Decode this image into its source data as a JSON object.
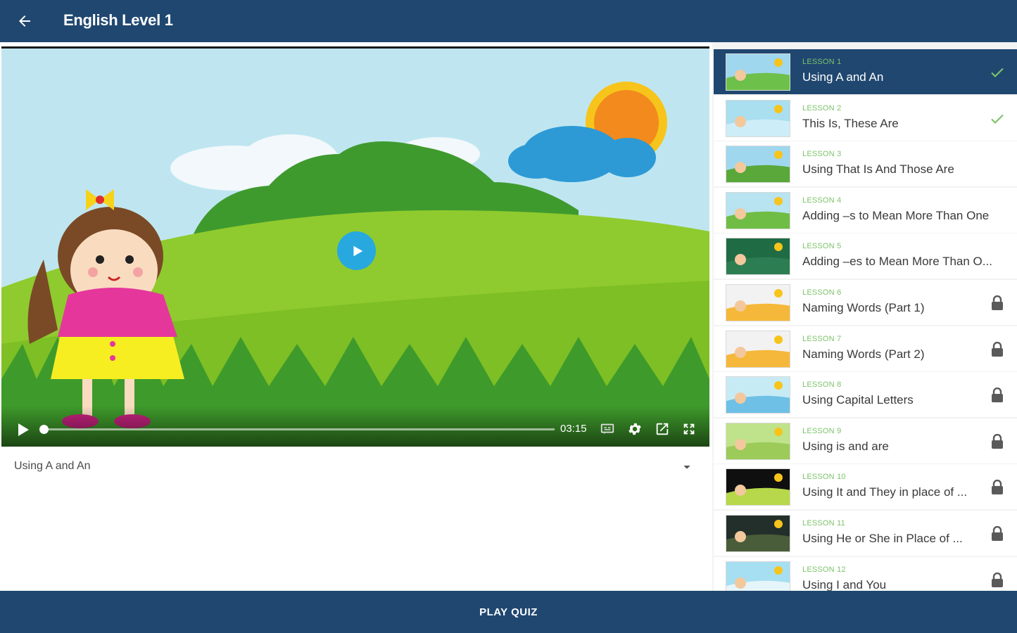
{
  "app": {
    "title": "English Level 1"
  },
  "player": {
    "current_time": "03:15",
    "progress": 0.0,
    "video_title": "Using A and An"
  },
  "lessons": [
    {
      "number": "LESSON 1",
      "name": "Using A and An",
      "status": "completed",
      "active": true
    },
    {
      "number": "LESSON 2",
      "name": "This Is, These Are",
      "status": "completed",
      "active": false
    },
    {
      "number": "LESSON 3",
      "name": "Using That Is And Those Are",
      "status": "none",
      "active": false
    },
    {
      "number": "LESSON 4",
      "name": "Adding –s to Mean More Than One",
      "status": "none",
      "active": false
    },
    {
      "number": "LESSON 5",
      "name": "Adding –es to Mean More Than O...",
      "status": "none",
      "active": false
    },
    {
      "number": "LESSON 6",
      "name": "Naming Words (Part 1)",
      "status": "locked",
      "active": false
    },
    {
      "number": "LESSON 7",
      "name": "Naming Words (Part 2)",
      "status": "locked",
      "active": false
    },
    {
      "number": "LESSON 8",
      "name": "Using Capital Letters",
      "status": "locked",
      "active": false
    },
    {
      "number": "LESSON 9",
      "name": "Using is and are",
      "status": "locked",
      "active": false
    },
    {
      "number": "LESSON 10",
      "name": "Using It and They in place of ...",
      "status": "locked",
      "active": false
    },
    {
      "number": "LESSON 11",
      "name": "Using He or She in Place of ...",
      "status": "locked",
      "active": false
    },
    {
      "number": "LESSON 12",
      "name": "Using I and You",
      "status": "locked",
      "active": false
    }
  ],
  "bottom": {
    "quiz_label": "PLAY QUIZ"
  },
  "colors": {
    "primary": "#1f4770",
    "accent_green": "#7cc36a",
    "play_blue": "#27a8df"
  }
}
